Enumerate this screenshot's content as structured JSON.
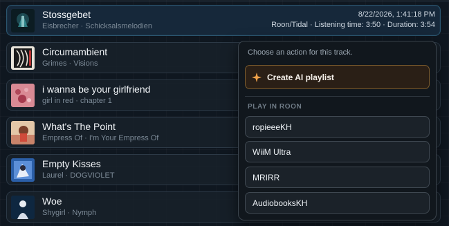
{
  "tracks": [
    {
      "title": "Stossgebet",
      "artist_album": "Eisbrecher · Schicksalsmelodien",
      "meta_line1": "8/22/2026, 1:41:18 PM",
      "meta_line2": "Roon/Tidal · Listening time: 3:50 · Duration: 3:54",
      "active": true
    },
    {
      "title": "Circumambient",
      "artist_album": "Grimes · Visions"
    },
    {
      "title": "i wanna be your girlfriend",
      "artist_album": "girl in red · chapter 1"
    },
    {
      "title": "What's The Point",
      "artist_album": "Empress Of · I'm Your Empress Of"
    },
    {
      "title": "Empty Kisses",
      "artist_album": "Laurel · DOGVIOLET"
    },
    {
      "title": "Woe",
      "artist_album": "Shygirl · Nymph"
    }
  ],
  "popup": {
    "prompt": "Choose an action for this track.",
    "ai_button_label": "Create AI playlist",
    "section_heading": "PLAY IN ROON",
    "zones": [
      "ropieeeKH",
      "WiiM Ultra",
      "MRIRR",
      "AudiobooksKH"
    ]
  },
  "colors": {
    "accent_orange": "#f0a24a",
    "active_row": "#16283a",
    "background": "#0f1720"
  },
  "icons": {
    "ai": "sparkle-icon"
  }
}
